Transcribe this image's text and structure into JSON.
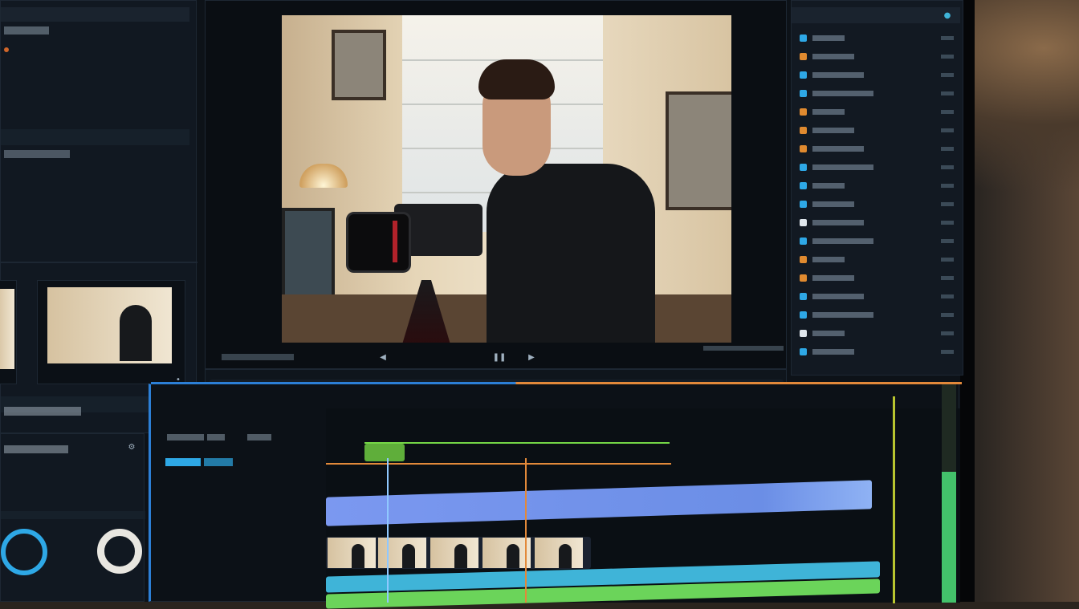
{
  "app": {
    "name": "Video editor"
  },
  "left_panel": {
    "title": "",
    "section": "",
    "footer_label": ""
  },
  "viewer": {
    "transport": [
      "◀",
      "❚❚",
      "▶"
    ]
  },
  "toolbar": {
    "timecode": ""
  },
  "timeline": {
    "header_labels": [
      "",
      "",
      ""
    ],
    "marker_labels": [
      "",
      "",
      "",
      ""
    ]
  },
  "right_panel": {
    "items": [
      "",
      "",
      "",
      "",
      "",
      "",
      "",
      "",
      "",
      "",
      "",
      "",
      "",
      "",
      "",
      "",
      "",
      ""
    ]
  },
  "colors": {
    "accent_blue": "#2c7fd6",
    "accent_orange": "#e2893a",
    "accent_green": "#74d646",
    "clip_blue": "#6b8ee6",
    "clip_cyan": "#3fb4d8",
    "clip_green": "#6bd45a"
  },
  "icons": [
    "play-icon",
    "pause-icon",
    "rewind-icon",
    "settings-icon",
    "close-icon"
  ]
}
